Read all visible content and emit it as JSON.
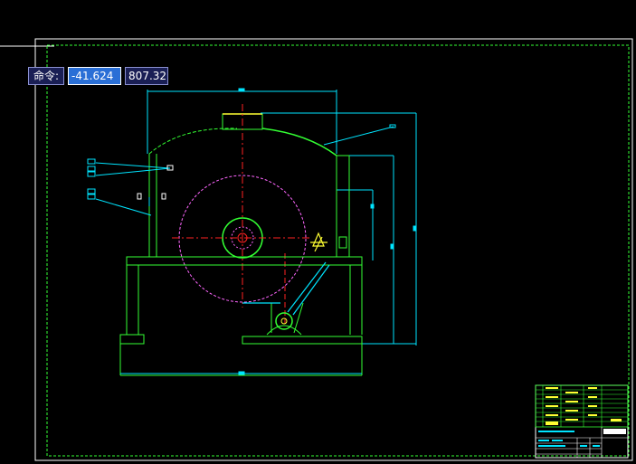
{
  "command": {
    "label": "命令:",
    "x_value": "-41.624",
    "y_value": "807.321"
  },
  "colors": {
    "background": "#000000",
    "outline_green": "#33ff33",
    "outline_cyan": "#00e5ff",
    "centerline_red": "#ff2222",
    "hidden_magenta": "#ff66ff",
    "highlight_yellow": "#ffff33",
    "frame_white": "#ffffff"
  }
}
